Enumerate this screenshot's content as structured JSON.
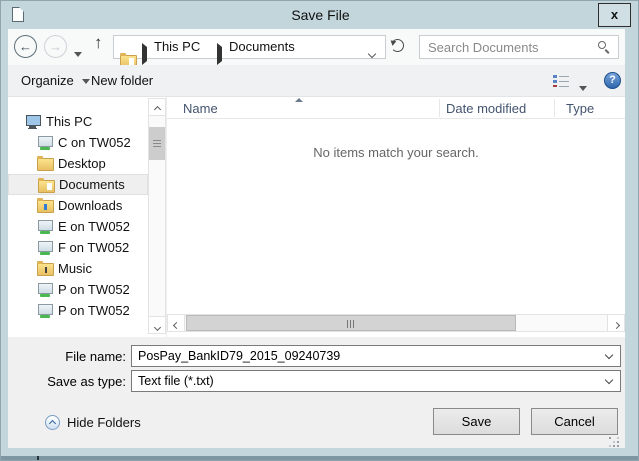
{
  "window": {
    "title": "Save File",
    "close_label": "x"
  },
  "navigation": {
    "breadcrumb": {
      "root": "This PC",
      "current": "Documents"
    },
    "search": {
      "placeholder": "Search Documents"
    }
  },
  "toolbar": {
    "organize_label": "Organize",
    "new_folder_label": "New folder"
  },
  "sidebar": {
    "items": [
      {
        "label": "This PC",
        "icon": "computer"
      },
      {
        "label": "C on TW052",
        "icon": "network-drive"
      },
      {
        "label": "Desktop",
        "icon": "folder-desktop"
      },
      {
        "label": "Documents",
        "icon": "folder-documents",
        "selected": true
      },
      {
        "label": "Downloads",
        "icon": "folder-downloads"
      },
      {
        "label": "E on TW052",
        "icon": "network-drive"
      },
      {
        "label": "F on TW052",
        "icon": "network-drive"
      },
      {
        "label": "Music",
        "icon": "folder-music"
      },
      {
        "label": "P on TW052",
        "icon": "network-drive"
      },
      {
        "label": "P on TW052",
        "icon": "network-drive"
      }
    ]
  },
  "file_list": {
    "columns": [
      {
        "label": "Name"
      },
      {
        "label": "Date modified"
      },
      {
        "label": "Type"
      }
    ],
    "empty_message": "No items match your search."
  },
  "footer": {
    "file_name_label": "File name:",
    "file_name_value": "PosPay_BankID79_2015_09240739",
    "save_as_type_label": "Save as type:",
    "save_as_type_value": "Text file (*.txt)",
    "hide_folders_label": "Hide Folders",
    "save_label": "Save",
    "cancel_label": "Cancel"
  },
  "icons": {
    "search-icon": "magnifier",
    "refresh-icon": "circular-arrow",
    "back-icon": "left-arrow-circle",
    "forward-icon": "right-arrow-circle",
    "up-icon": "up-arrow",
    "help-icon": "blue-question-circle",
    "views-icon": "details-list",
    "sort-ascending-icon": "triangle-up",
    "hide-folders-icon": "up-chevron-circle"
  },
  "colors": {
    "frame": "#c2d6dc",
    "toolbar_bg": "#f0f1f2",
    "footer_bg": "#f0f0f0",
    "header_text": "#43546e",
    "help_accent": "#2f66ad",
    "drive_green": "#49b84f",
    "folder_yellow": "#e9bf62"
  }
}
